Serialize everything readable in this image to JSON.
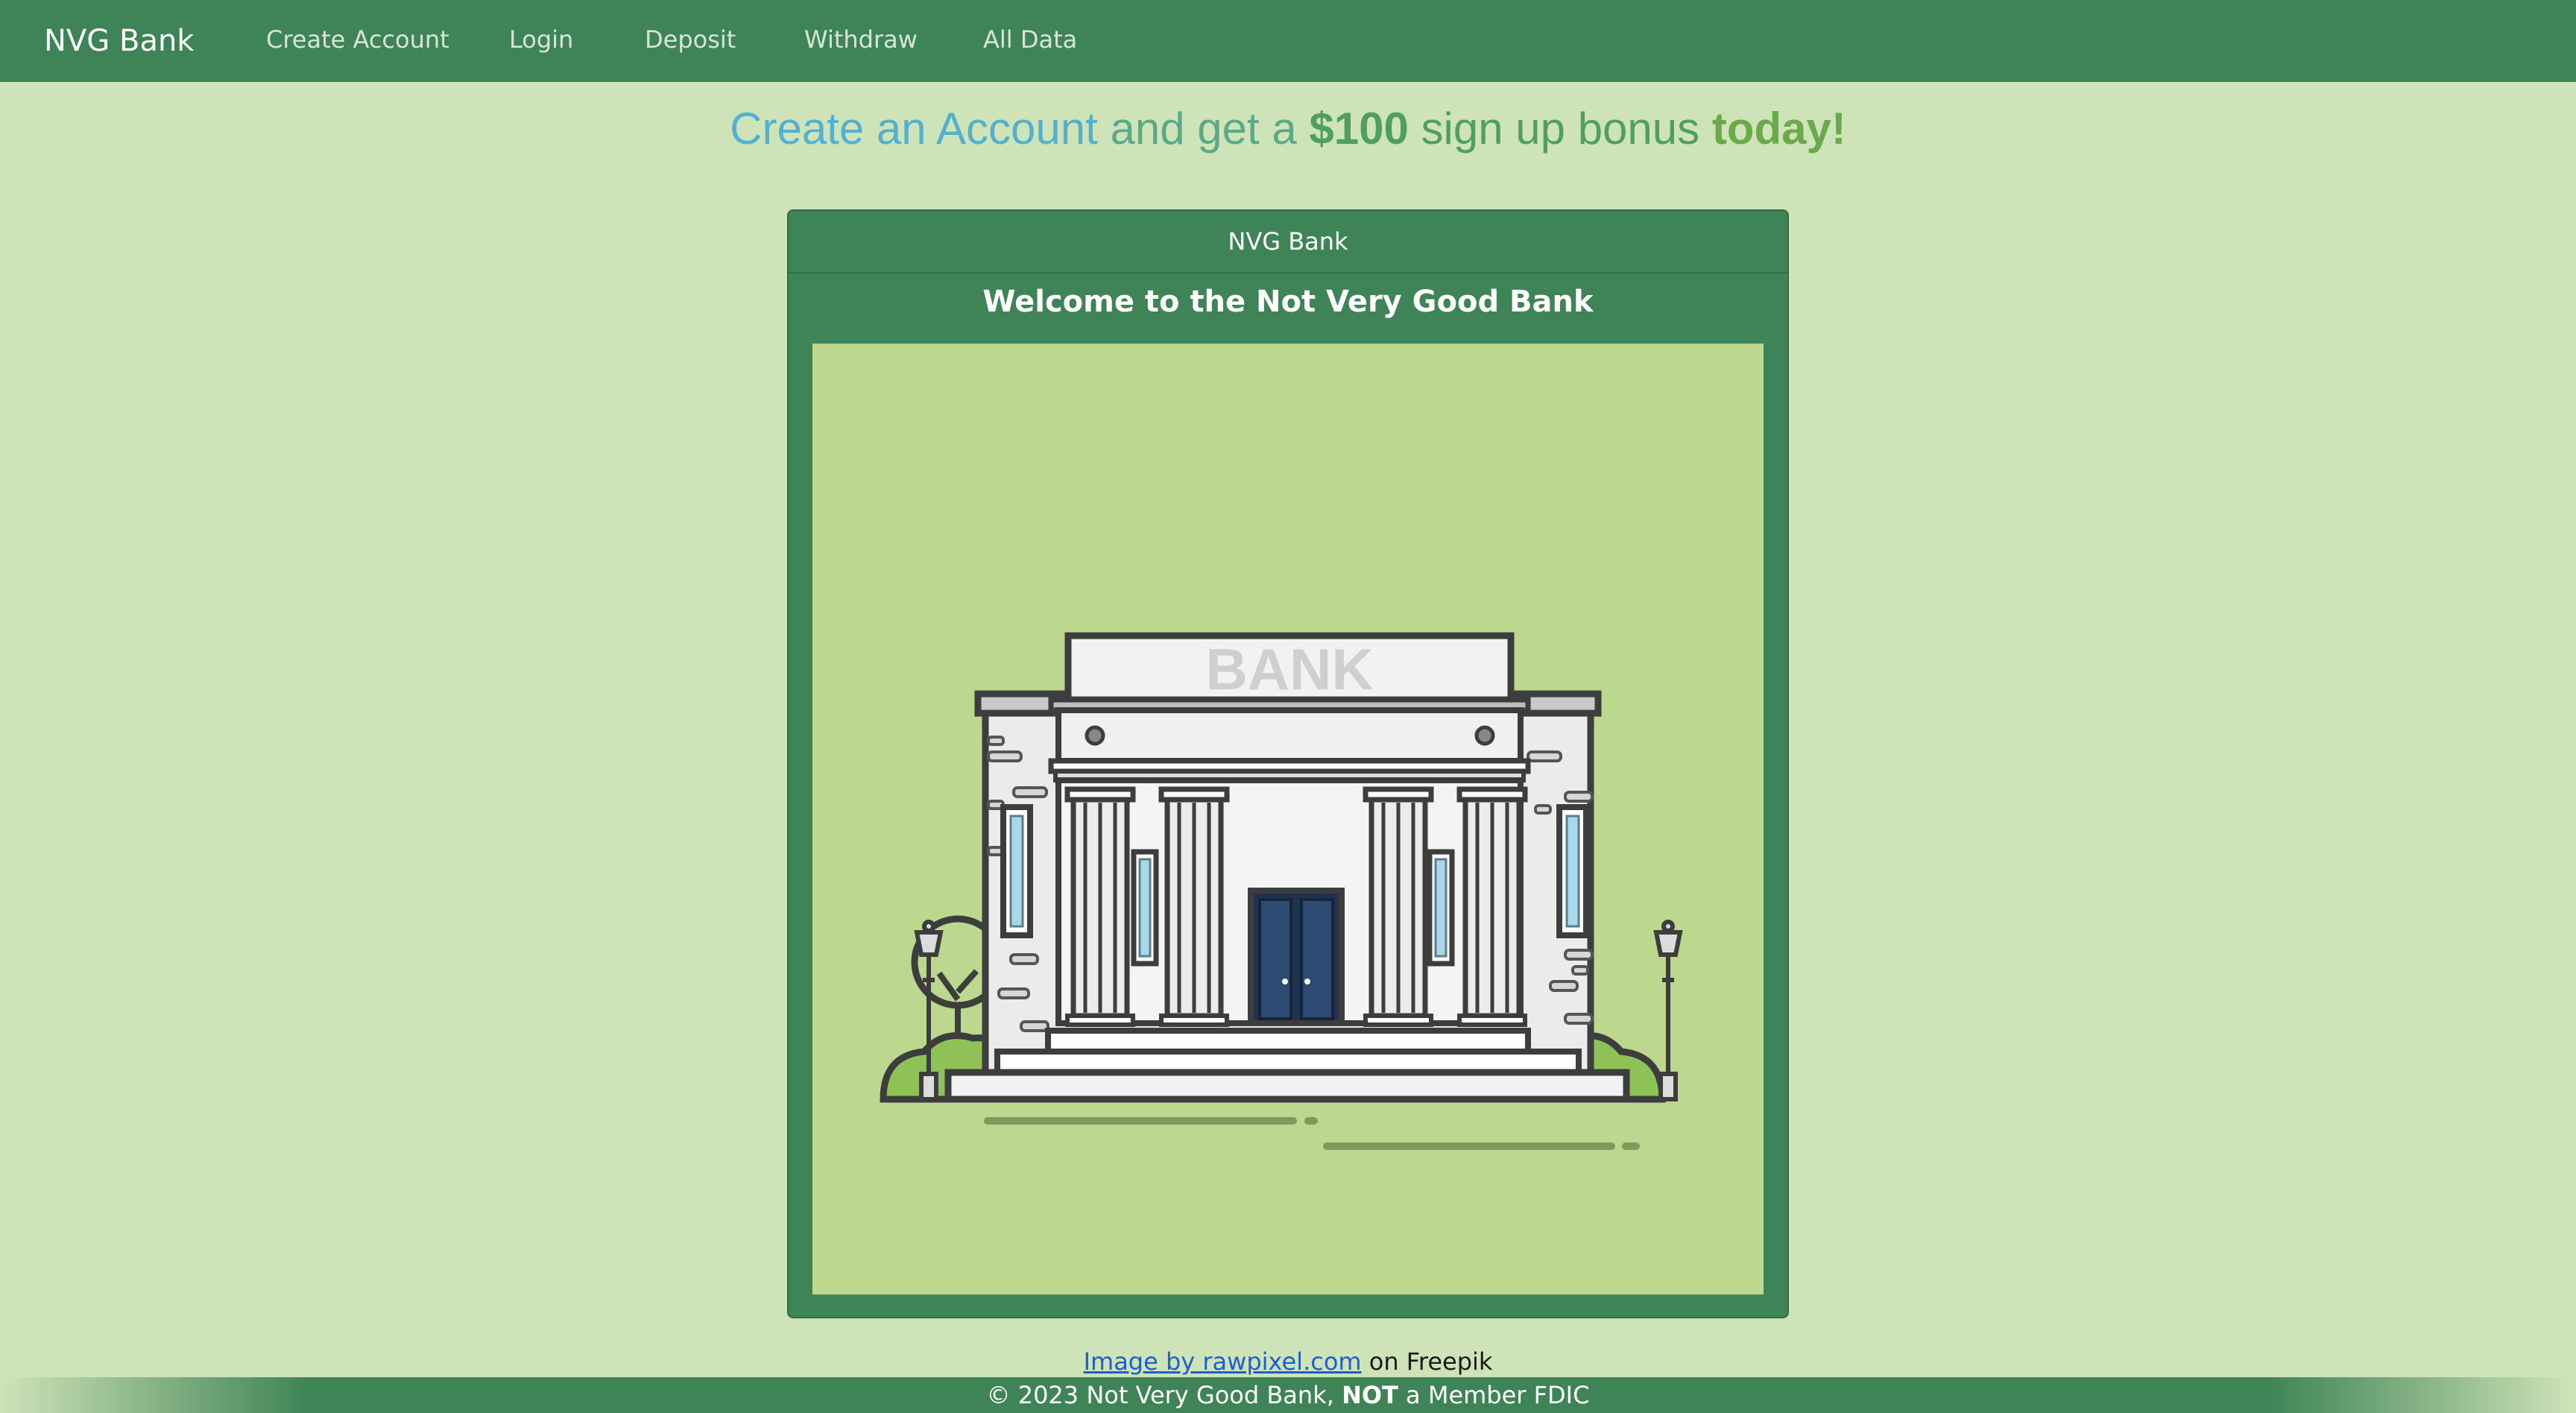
{
  "navbar": {
    "brand": "NVG Bank",
    "links": [
      "Create Account",
      "Login",
      "Deposit",
      "Withdraw",
      "All Data"
    ]
  },
  "headline": {
    "part1": "Create an Account",
    "part2": " and get a ",
    "part3": "$100",
    "part4": " sign up bonus ",
    "part5": "today!"
  },
  "card": {
    "header": "NVG Bank",
    "title": "Welcome to the Not Very Good Bank",
    "image_sign_text": "BANK"
  },
  "credit": {
    "link_text": "Image by rawpixel.com",
    "suffix": " on Freepik"
  },
  "footer": {
    "prefix": "© 2023 Not Very Good Bank, ",
    "bold": "NOT",
    "suffix": " a Member FDIC"
  },
  "colors": {
    "page_bg": "#cfe3b8",
    "navbar_bg": "#3e8456",
    "image_bg": "#bcd78e"
  }
}
